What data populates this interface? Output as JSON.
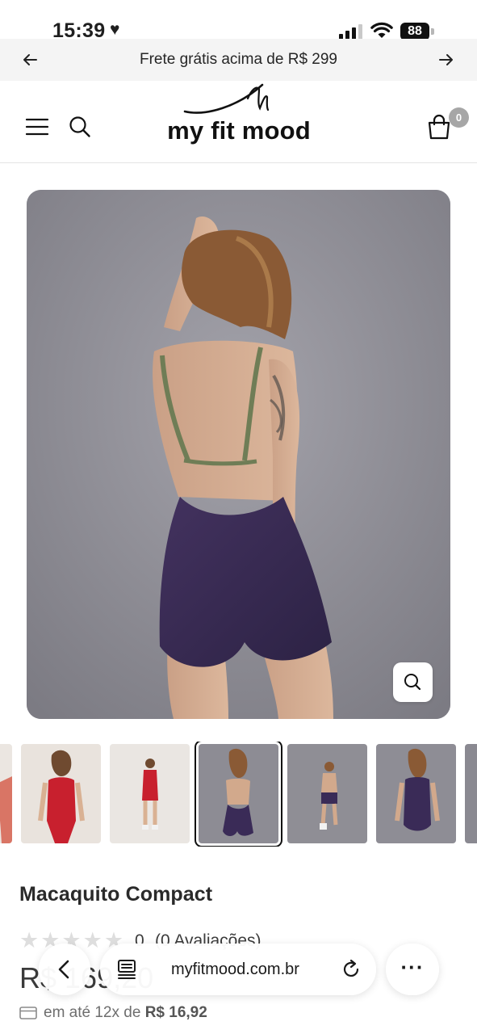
{
  "status_bar": {
    "time": "15:39",
    "battery": "88",
    "icons": [
      "heart-icon",
      "cellular-signal-icon",
      "wifi-icon",
      "battery-icon"
    ]
  },
  "announcement": {
    "text": "Frete grátis acima de R$ 299",
    "prev_icon": "arrow-left-icon",
    "next_icon": "arrow-right-icon"
  },
  "header": {
    "logo_text": "my fit mood",
    "menu_icon": "hamburger-menu-icon",
    "search_icon": "search-icon",
    "cart_icon": "shopping-bag-icon",
    "cart_count": "0"
  },
  "product": {
    "main_image": "woman-back-view-purple-jumpsuit",
    "zoom_icon": "zoom-icon",
    "thumbnails": [
      {
        "image": "red-jumpsuit-partial",
        "active": false
      },
      {
        "image": "red-jumpsuit-front",
        "active": false
      },
      {
        "image": "red-jumpsuit-full-body",
        "active": false
      },
      {
        "image": "purple-jumpsuit-back",
        "active": true
      },
      {
        "image": "purple-jumpsuit-back-full-body",
        "active": false
      },
      {
        "image": "purple-jumpsuit-front",
        "active": false
      },
      {
        "image": "purple-jumpsuit-partial",
        "active": false
      }
    ],
    "title": "Macaquito Compact",
    "rating_count": "0",
    "reviews_label": "(0 Avaliações)",
    "price": "R$ 169,20",
    "installments_text": "em até 12x de",
    "installments_value": "R$ 16,92"
  },
  "browser": {
    "url": "myfitmood.com.br",
    "back_icon": "chevron-left-icon",
    "reader_icon": "reader-mode-icon",
    "reload_icon": "reload-icon",
    "more_icon": "more-dots-icon",
    "more_label": "···"
  },
  "colors": {
    "accent": "#111111",
    "announcement_bg": "#f4f4f4",
    "badge": "#a6a6a6",
    "jumpsuit_purple": "#3a2b57",
    "jumpsuit_red": "#c8202e"
  }
}
